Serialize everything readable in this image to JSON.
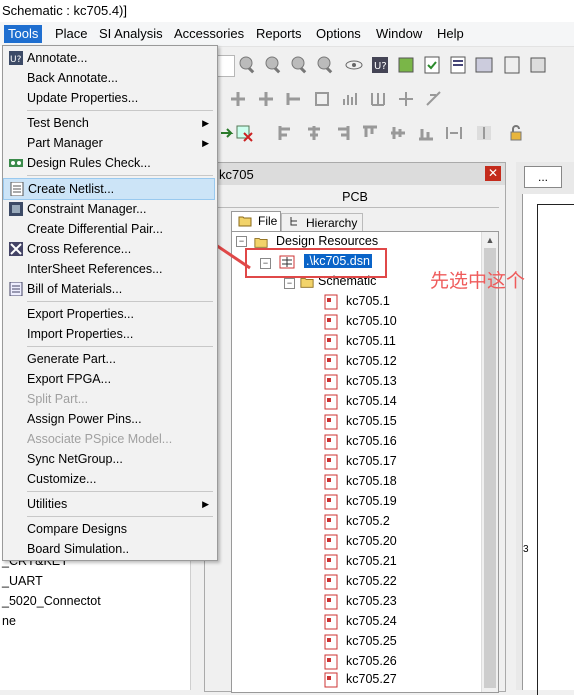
{
  "window": {
    "title": "Schematic : kc705.4)]"
  },
  "menubar": {
    "items": [
      "Tools",
      "Place",
      "SI Analysis",
      "Accessories",
      "Reports",
      "Options",
      "Window",
      "Help"
    ]
  },
  "tools_menu": {
    "items": [
      {
        "label": "Annotate...",
        "icon": "annotate-icon"
      },
      {
        "label": "Back Annotate..."
      },
      {
        "label": "Update Properties..."
      },
      {
        "label": "Test Bench",
        "submenu": true
      },
      {
        "label": "Part Manager",
        "submenu": true
      },
      {
        "label": "Design Rules Check...",
        "icon": "drc-icon"
      },
      {
        "label": "Create Netlist...",
        "icon": "netlist-icon",
        "highlighted": true
      },
      {
        "label": "Constraint Manager...",
        "icon": "constraint-icon"
      },
      {
        "label": "Create Differential Pair..."
      },
      {
        "label": "Cross Reference...",
        "icon": "cross-ref-icon"
      },
      {
        "label": "InterSheet References..."
      },
      {
        "label": "Bill of Materials...",
        "icon": "bom-icon"
      },
      {
        "label": "Export Properties..."
      },
      {
        "label": "Import Properties..."
      },
      {
        "label": "Generate Part..."
      },
      {
        "label": "Export FPGA..."
      },
      {
        "label": "Split Part...",
        "disabled": true
      },
      {
        "label": "Assign Power Pins..."
      },
      {
        "label": "Associate PSpice Model...",
        "disabled": true
      },
      {
        "label": "Sync NetGroup..."
      },
      {
        "label": "Customize..."
      },
      {
        "label": "Utilities",
        "submenu": true
      },
      {
        "label": "Compare Designs"
      },
      {
        "label": "Board Simulation.."
      }
    ]
  },
  "left_panel": {
    "items": [
      "_CRY&KEY",
      "_UART",
      "_5020_Connectot",
      "ne"
    ]
  },
  "project_window": {
    "title": "kc705",
    "tab_label": "PCB",
    "file_tab": "File",
    "hierarchy_tab": "Hierarchy",
    "design_resources": "Design Resources",
    "design_file": ".\\kc705.dsn",
    "schematic_folder": "Schematic",
    "pages": [
      "kc705.1",
      "kc705.10",
      "kc705.11",
      "kc705.12",
      "kc705.13",
      "kc705.14",
      "kc705.15",
      "kc705.16",
      "kc705.17",
      "kc705.18",
      "kc705.19",
      "kc705.2",
      "kc705.20",
      "kc705.21",
      "kc705.22",
      "kc705.23",
      "kc705.24",
      "kc705.25",
      "kc705.26",
      "kc705.27"
    ]
  },
  "right_area": {
    "tab_label": "...",
    "border_mark": "3"
  },
  "annotation": {
    "text": "先选中这个",
    "color": "#ef5b5b"
  },
  "colors": {
    "menu_active": "#1f6fd0",
    "highlight": "#cce4f7",
    "annotation_red": "#e04848"
  }
}
